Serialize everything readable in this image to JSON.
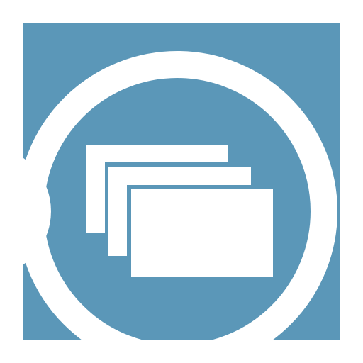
{
  "icon": {
    "name": "stacked-windows-icon",
    "background_color": "#ffffff",
    "tile_color": "#5b97b8",
    "glyph_color": "#ffffff",
    "window_count": 3
  }
}
